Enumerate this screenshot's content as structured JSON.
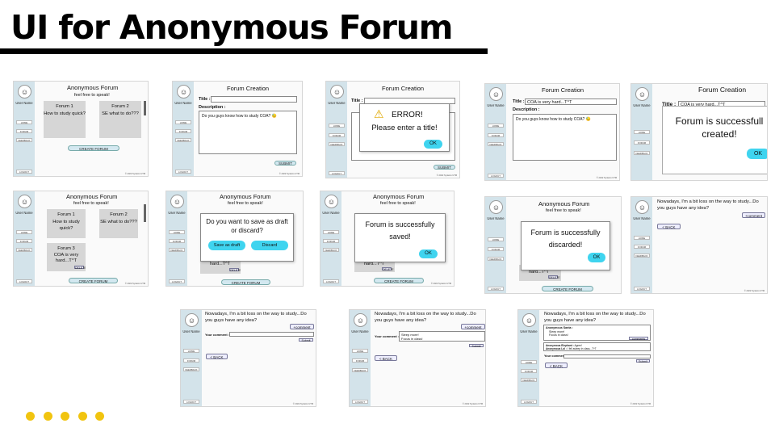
{
  "slide": {
    "title": "UI for Anonymous Forum"
  },
  "common": {
    "user_name": "User Name",
    "nav": [
      "HOME",
      "FORUM",
      "FEEDBACK"
    ],
    "logout": "LOGOUT",
    "footer": "© 2022 Syntetro UTM",
    "avatar_glyph": "☺",
    "avatar_icon": "person-avatar-icon"
  },
  "home": {
    "title": "Anonymous Forum",
    "subtitle": "feel free to speak!",
    "forum1": {
      "title": "Forum 1",
      "body": "How to study quick?"
    },
    "forum2": {
      "title": "Forum 2",
      "body": "SE what to do???"
    },
    "forum3": {
      "title": "Forum 3",
      "body": "COA is very hard...T^T"
    },
    "forum3_short": "hard...T^T",
    "delete": "DELETE",
    "create": "CREATE FORUM"
  },
  "creation": {
    "heading": "Forum Creation",
    "title_label": "Title :",
    "title_value_short": "COA is very hard...T^T",
    "title_value": "COA is very hard...T^T",
    "description_label": "Description :",
    "description_value": "Do you guys know how to study COA? 😓",
    "submit": "SUBMIT"
  },
  "dialogs": {
    "error_title": "ERROR!",
    "error_message": "Please enter a title!",
    "ok": "OK",
    "created": "Forum is successfull created!",
    "save_question": "Do you want to save as draft or discard?",
    "save_draft": "Save as draft",
    "discard": "Discard",
    "saved": "Forum is successfully saved!",
    "discarded": "Forum is successfully discarded!"
  },
  "thread": {
    "question": "Nowadays, I'm a bit loss on the way to study...Do you guys have any idea?",
    "comment_button": "+comment",
    "back_button": "< BACK",
    "your_comment_label": "Your comment :",
    "comment_draft": "Sleep more!",
    "comment_draft_line2": "Focus in class!",
    "submit": "Submit",
    "posted_author": "Anonymous Santa :",
    "posted_line1": "Sleep more!",
    "posted_line2": "Focus in class!",
    "comments_button": "comments",
    "reply1_author": "Anonymous Elephant :",
    "reply1_text": "Agree!",
    "reply2_author": "Anonymous Lol :",
    "reply2_text": "I fell asleep in class...T^T"
  },
  "colors": {
    "accent_button": "#3fd4ef",
    "sidebar": "#d3e3ea",
    "bullet": "#f1c40f"
  }
}
